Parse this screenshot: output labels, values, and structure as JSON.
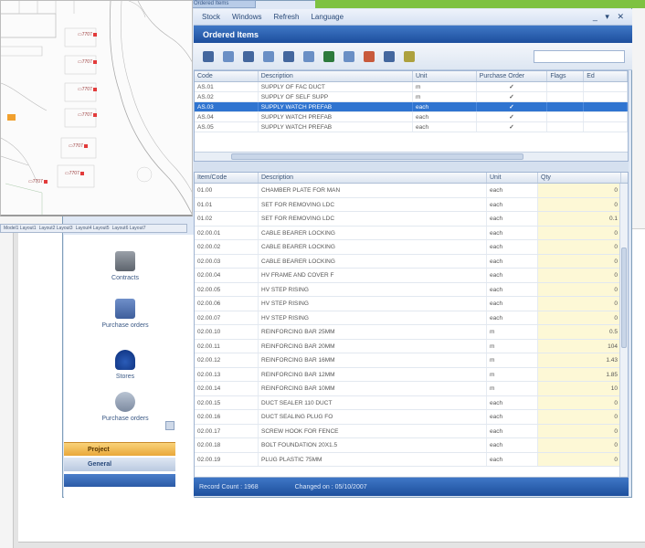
{
  "app": {
    "title_tab": "Ordered Items",
    "menu": [
      "Stock",
      "Windows",
      "Refresh",
      "Language"
    ],
    "window_controls": "_ ▾ ✕",
    "pane_title": "Ordered Items",
    "toolbar_icons": [
      "form-icon",
      "grid-icon",
      "filter-icon",
      "copy-icon",
      "back-arrow-icon",
      "print-icon",
      "chart-icon",
      "edit-icon",
      "refresh-icon",
      "save-icon",
      "help-icon"
    ]
  },
  "upper_grid": {
    "columns": [
      "Code",
      "Description",
      "Unit",
      "Purchase Order",
      "Flags",
      "Ed"
    ],
    "rows": [
      {
        "code": "AS.01",
        "desc": "SUPPLY OF FAC DUCT",
        "unit": "m",
        "check": "✓",
        "selected": false
      },
      {
        "code": "AS.02",
        "desc": "SUPPLY OF SELF SUPP",
        "unit": "m",
        "check": "✓",
        "selected": false
      },
      {
        "code": "AS.03",
        "desc": "SUPPLY WATCH PREFAB",
        "unit": "each",
        "check": "✓",
        "selected": true
      },
      {
        "code": "AS.04",
        "desc": "SUPPLY WATCH PREFAB",
        "unit": "each",
        "check": "✓",
        "selected": false
      },
      {
        "code": "AS.05",
        "desc": "SUPPLY WATCH PREFAB",
        "unit": "each",
        "check": "✓",
        "selected": false
      }
    ]
  },
  "lower_grid": {
    "columns": [
      "Item/Code",
      "Description",
      "Unit",
      "Qty"
    ],
    "rows": [
      {
        "code": "01.00",
        "desc": "CHAMBER PLATE FOR MAN",
        "unit": "each",
        "qty": "0"
      },
      {
        "code": "01.01",
        "desc": "SET FOR REMOVING LDC",
        "unit": "each",
        "qty": "0"
      },
      {
        "code": "01.02",
        "desc": "SET FOR REMOVING LDC",
        "unit": "each",
        "qty": "0.1"
      },
      {
        "code": "02.00.01",
        "desc": "CABLE BEARER LOCKING",
        "unit": "each",
        "qty": "0"
      },
      {
        "code": "02.00.02",
        "desc": "CABLE BEARER LOCKING",
        "unit": "each",
        "qty": "0"
      },
      {
        "code": "02.00.03",
        "desc": "CABLE BEARER LOCKING",
        "unit": "each",
        "qty": "0"
      },
      {
        "code": "02.00.04",
        "desc": "HV FRAME AND COVER F",
        "unit": "each",
        "qty": "0"
      },
      {
        "code": "02.00.05",
        "desc": "HV STEP RISING",
        "unit": "each",
        "qty": "0"
      },
      {
        "code": "02.00.06",
        "desc": "HV STEP RISING",
        "unit": "each",
        "qty": "0"
      },
      {
        "code": "02.00.07",
        "desc": "HV STEP RISING",
        "unit": "each",
        "qty": "0"
      },
      {
        "code": "02.00.10",
        "desc": "REINFORCING BAR 25MM",
        "unit": "m",
        "qty": "0.5"
      },
      {
        "code": "02.00.11",
        "desc": "REINFORCING BAR 20MM",
        "unit": "m",
        "qty": "104"
      },
      {
        "code": "02.00.12",
        "desc": "REINFORCING BAR 16MM",
        "unit": "m",
        "qty": "1.43"
      },
      {
        "code": "02.00.13",
        "desc": "REINFORCING BAR 12MM",
        "unit": "m",
        "qty": "1.85"
      },
      {
        "code": "02.00.14",
        "desc": "REINFORCING BAR 10MM",
        "unit": "m",
        "qty": "10"
      },
      {
        "code": "02.00.15",
        "desc": "DUCT SEALER 110 DUCT",
        "unit": "each",
        "qty": "0"
      },
      {
        "code": "02.00.16",
        "desc": "DUCT SEALING PLUG FO",
        "unit": "each",
        "qty": "0"
      },
      {
        "code": "02.00.17",
        "desc": "SCREW HOOK FOR FENCE",
        "unit": "each",
        "qty": "0"
      },
      {
        "code": "02.00.18",
        "desc": "BOLT FOUNDATION 20X1.5",
        "unit": "each",
        "qty": "0"
      },
      {
        "code": "02.00.19",
        "desc": "PLUG PLASTIC 75MM",
        "unit": "each",
        "qty": "0"
      }
    ]
  },
  "status": [
    "Record Count : 1968",
    "Changed on : 05/10/2007"
  ],
  "nav": {
    "items": [
      {
        "label": "Contracts",
        "icon": "contracts-icon"
      },
      {
        "label": "Purchase orders",
        "icon": "purchase-orders-icon"
      },
      {
        "label": "Stores",
        "icon": "stores-icon"
      },
      {
        "label": "Purchase orders",
        "icon": "search-icon"
      }
    ],
    "buttons": [
      "Project",
      "General",
      ""
    ]
  },
  "map": {
    "tags": [
      {
        "text": "▭7707"
      },
      {
        "text": "▭7707"
      },
      {
        "text": "▭7707"
      },
      {
        "text": "▭7707"
      },
      {
        "text": "▭7707"
      },
      {
        "text": "▭7707"
      },
      {
        "text": "▭7707"
      }
    ],
    "tabs": [
      "Model1 Layout1",
      "Layout2 Layout3",
      "Layout4 Layout5",
      "Layout6 Layout7"
    ]
  }
}
